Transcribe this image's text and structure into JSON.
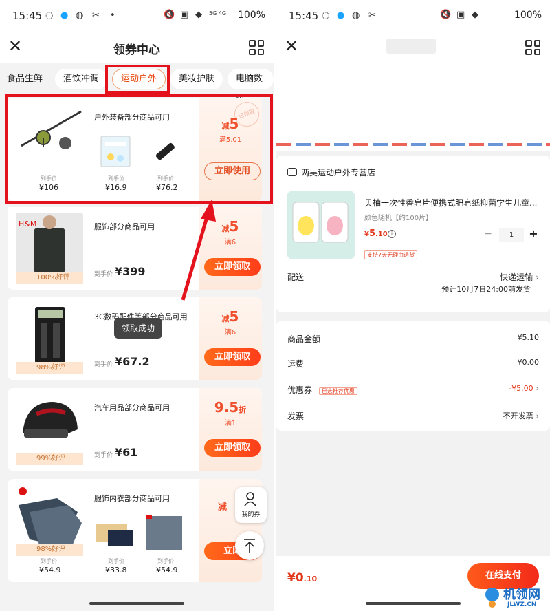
{
  "left": {
    "status": {
      "time": "15:45",
      "battery": "100%",
      "net": "5G 4G",
      "dot": "•"
    },
    "nav": {
      "title": "领券中心"
    },
    "tabs": [
      "食品生鲜",
      "酒饮冲调",
      "运动户外",
      "美妆护肤",
      "电脑数码"
    ],
    "cards": [
      {
        "title": "户外装备部分商品可用",
        "amount": "5",
        "prefix": "减",
        "condition": "满5.01",
        "button": "立即使用",
        "items": [
          {
            "label": "到手价",
            "price": "¥106"
          },
          {
            "label": "到手价",
            "price": "¥16.9"
          },
          {
            "label": "到手价",
            "price": "¥76.2"
          }
        ],
        "stamp": "已领取"
      },
      {
        "title": "服饰部分商品可用",
        "amount": "5",
        "prefix": "减",
        "condition": "满6",
        "button": "立即领取",
        "price_label": "到手价",
        "price": "¥399",
        "rating": "100%好评",
        "brand": "H&M"
      },
      {
        "title": "3C数码配件等部分商品可用",
        "amount": "5",
        "prefix": "减",
        "condition": "满6",
        "button": "立即领取",
        "price_label": "到手价",
        "price": "¥67.2",
        "rating": "98%好评"
      },
      {
        "title": "汽车用品部分商品可用",
        "amount": "9.5",
        "suffix": "折",
        "condition": "满1",
        "button": "立即领取",
        "price_label": "到手价",
        "price": "¥61",
        "rating": "99%好评"
      },
      {
        "title": "服饰内衣部分商品可用",
        "prefix": "减",
        "button": "立即",
        "rating": "98%好评",
        "items": [
          {
            "label": "到手价",
            "price": "¥54.9"
          },
          {
            "label": "到手价",
            "price": "¥33.8"
          },
          {
            "label": "到手价",
            "price": "¥54.9"
          }
        ]
      }
    ],
    "toast": "领取成功",
    "my_coupon": "我的券"
  },
  "right": {
    "status": {
      "time": "15:45",
      "battery": "100%"
    },
    "store": "两吴运动户外专营店",
    "goods": {
      "name": "贝柚一次性香皂片便携式肥皂纸抑菌学生儿童...",
      "spec": "颜色随机【约100片】",
      "price_prefix": "¥",
      "price": "5",
      "price_decimal": ".10",
      "qty": "1",
      "tag": "支持7天无理由退货"
    },
    "delivery": {
      "label": "配送",
      "method": "快递运输",
      "eta": "预计10月7日24:00前发货"
    },
    "summary": [
      {
        "label": "商品金额",
        "value": "¥5.10"
      },
      {
        "label": "运费",
        "value": "¥0.00"
      },
      {
        "label": "优惠券",
        "tag": "已选推荐优惠",
        "value": "-¥5.00"
      },
      {
        "label": "发票",
        "value": "不开发票"
      }
    ],
    "pay": {
      "total": "¥0",
      "total_decimal": ".10",
      "button": "在线支付"
    },
    "watermark": {
      "name": "机领网",
      "url": "JLWZ.CN"
    }
  },
  "colors": {
    "accent": "#ff4a1a",
    "highlight": "#e3121c",
    "price": "#e23a1d"
  }
}
